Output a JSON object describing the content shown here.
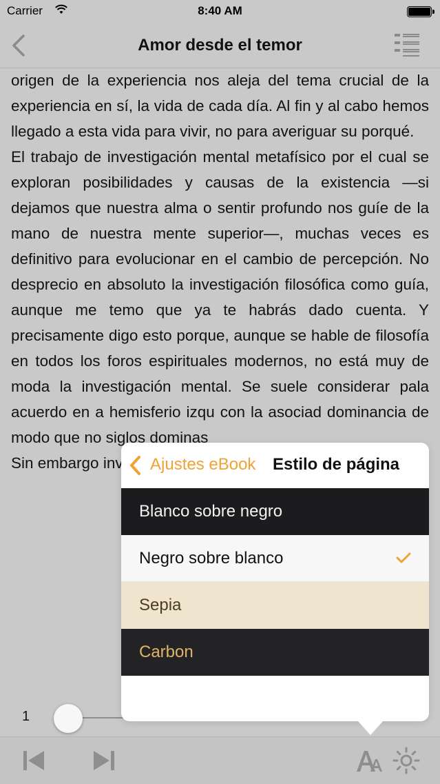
{
  "status_bar": {
    "carrier": "Carrier",
    "time": "8:40 AM"
  },
  "nav": {
    "title": "Amor desde el temor"
  },
  "content": {
    "paragraphs": [
      "origen de la experiencia nos aleja del tema crucial de la experiencia en sí, la vida de cada día. Al fin y al cabo hemos llegado a esta vida para vivir, no para averiguar su porqué.",
      "El trabajo de investigación mental metafísico por el cual se exploran posibilidades y causas de la existencia —si dejamos que nuestra alma o sentir profundo nos guíe de la mano de nuestra mente superior—, muchas veces es definitivo para evolucionar en el cambio de percepción. No desprecio en absoluto la investigación filosófica como guía, aunque me temo que ya te habrás dado cuenta. Y precisamente digo esto porque, aunque se hable de filosofía en todos los foros espirituales modernos, no está muy de moda la investigación mental. Se suele considerar pala acuerdo en a hemisferio izqu con la asociad dominancia de modo que no siglos dominas",
      "Sin embargo investigación objetivo válido: desarr do"
    ]
  },
  "reader": {
    "page_number": "1",
    "progress": 0.0
  },
  "popover": {
    "back_label": "Ajustes eBook",
    "title": "Estilo de página",
    "options": [
      {
        "label": "Blanco sobre negro",
        "selected": false
      },
      {
        "label": "Negro sobre blanco",
        "selected": true
      },
      {
        "label": "Sepia",
        "selected": false
      },
      {
        "label": "Carbon",
        "selected": false
      }
    ]
  },
  "colors": {
    "accent": "#f0a234",
    "background": "#c9c9c9",
    "row_black": "#1c1c1e",
    "row_white": "#f7f7f7",
    "row_sepia": "#efe5cf",
    "row_carbon": "#232325"
  },
  "icons": {
    "back": "chevron-left-icon",
    "toc": "table-of-contents-icon",
    "prev": "previous-chapter-icon",
    "next": "next-chapter-icon",
    "font": "font-size-icon",
    "brightness": "brightness-icon",
    "check": "checkmark-icon"
  }
}
